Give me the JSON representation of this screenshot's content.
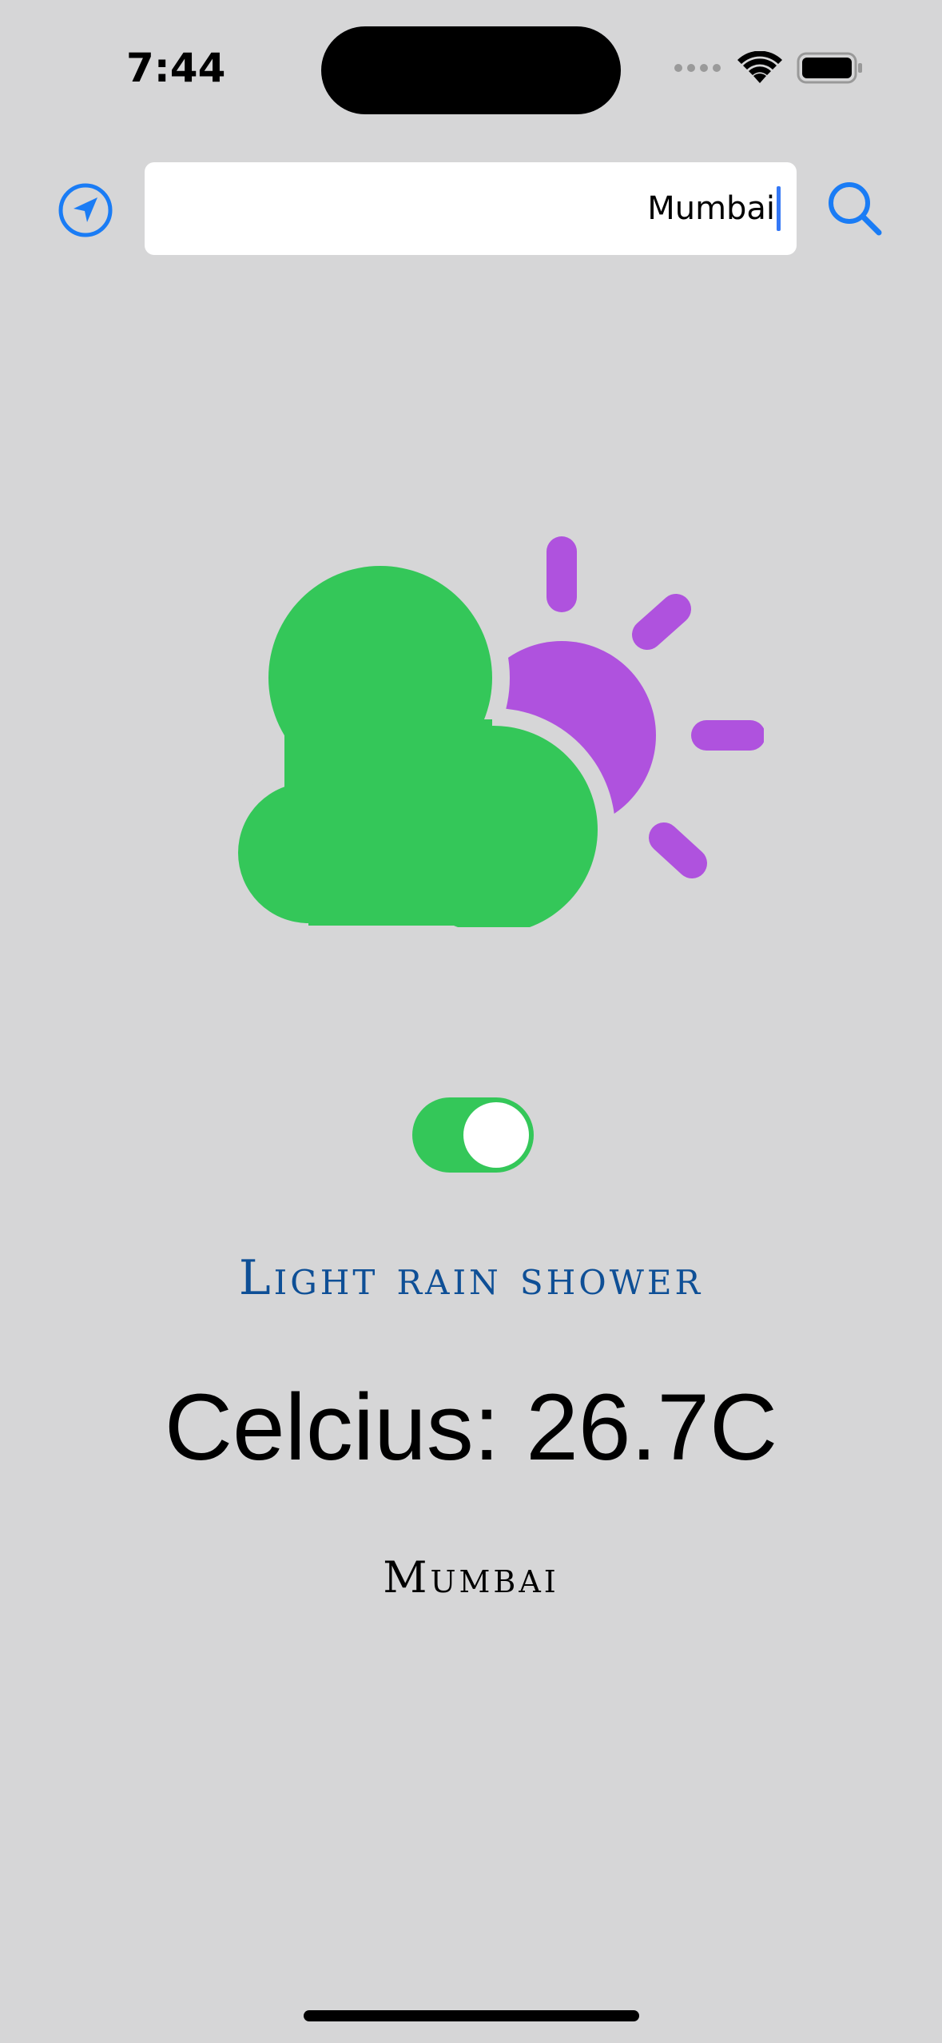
{
  "status_bar": {
    "time": "7:44"
  },
  "search": {
    "value": "Mumbai",
    "location_icon": "location-arrow-icon",
    "search_icon": "magnifyingglass-icon"
  },
  "weather": {
    "icon": "cloud-sun-icon",
    "condition": "Light rain shower",
    "temperature": "Celcius: 26.7C",
    "city": "Mumbai"
  },
  "toggle": {
    "on": true
  },
  "colors": {
    "background": "#d6d6d7",
    "accent": "#1a7cf5",
    "cloud": "#34c759",
    "sun": "#af52de",
    "condition_text": "#0e4f96"
  }
}
